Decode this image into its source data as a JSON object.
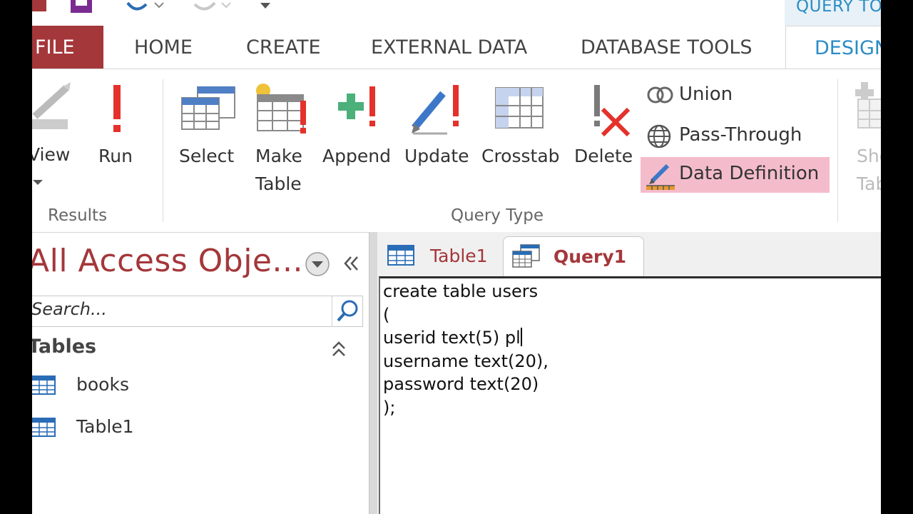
{
  "contextual_tab_group": "QUERY TOOLS",
  "ribbon_tabs": [
    "FILE",
    "HOME",
    "CREATE",
    "EXTERNAL DATA",
    "DATABASE TOOLS",
    "DESIGN"
  ],
  "results_group": {
    "label": "Results",
    "view_label": "View",
    "run_label": "Run"
  },
  "query_type_group": {
    "label": "Query Type",
    "select_label": "Select",
    "make_table_label_line1": "Make",
    "make_table_label_line2": "Table",
    "append_label": "Append",
    "update_label": "Update",
    "crosstab_label": "Crosstab",
    "delete_label": "Delete",
    "union_label": "Union",
    "pass_through_label": "Pass-Through",
    "data_definition_label": "Data Definition"
  },
  "show_table": {
    "label_line1": "Show",
    "label_line2": "Table"
  },
  "nav_pane": {
    "title": "All Access Obje...",
    "search_placeholder": "Search...",
    "section": "Tables",
    "items": [
      "books",
      "Table1"
    ]
  },
  "doc_tabs": [
    "Table1",
    "Query1"
  ],
  "editor": {
    "sql": "create table users\n(\nuserid text(5) pl\nusername text(20),\npassword text(20)\n);"
  },
  "colors": {
    "file_tab": "#a4373a",
    "accent": "#2a8dc5",
    "highlight": "#f4bccb"
  }
}
